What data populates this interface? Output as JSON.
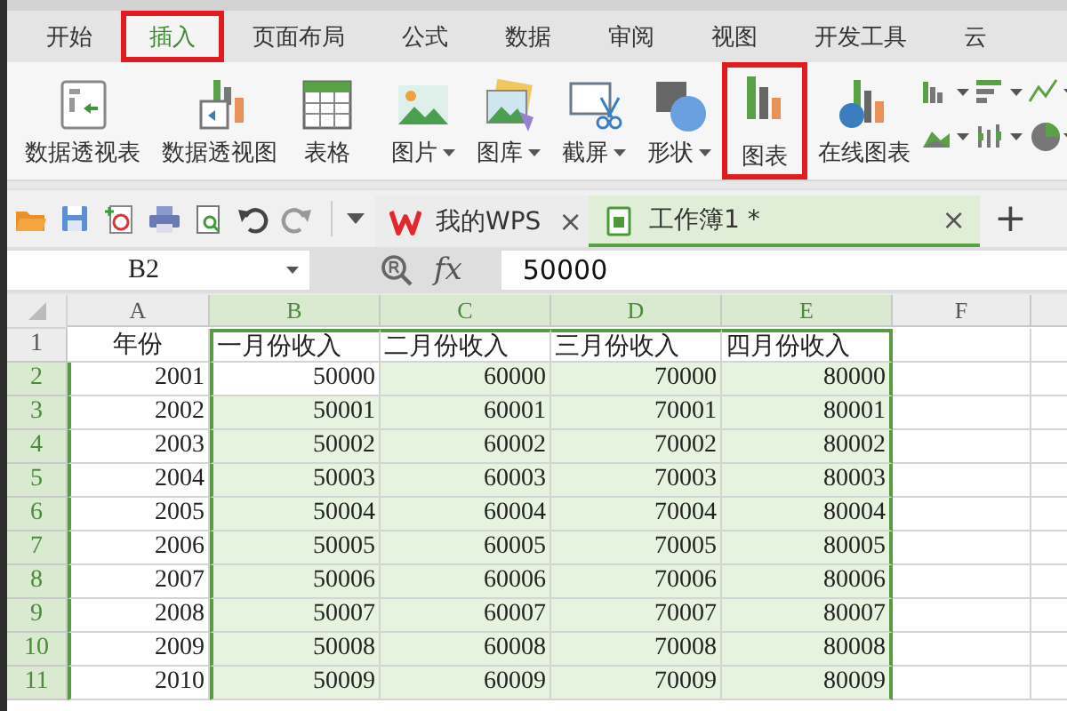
{
  "tabs": [
    {
      "label": "开始",
      "selected": false,
      "highlighted": false
    },
    {
      "label": "插入",
      "selected": true,
      "highlighted": true
    },
    {
      "label": "页面布局",
      "selected": false,
      "highlighted": false
    },
    {
      "label": "公式",
      "selected": false,
      "highlighted": false
    },
    {
      "label": "数据",
      "selected": false,
      "highlighted": false
    },
    {
      "label": "审阅",
      "selected": false,
      "highlighted": false
    },
    {
      "label": "视图",
      "selected": false,
      "highlighted": false
    },
    {
      "label": "开发工具",
      "selected": false,
      "highlighted": false
    },
    {
      "label": "云",
      "selected": false,
      "highlighted": false
    }
  ],
  "ribbon": {
    "items": [
      {
        "label": "数据透视表",
        "dropdown": false,
        "highlighted": false
      },
      {
        "label": "数据透视图",
        "dropdown": false,
        "highlighted": false
      },
      {
        "label": "表格",
        "dropdown": false,
        "highlighted": false
      },
      {
        "label": "图片",
        "dropdown": true,
        "highlighted": false
      },
      {
        "label": "图库",
        "dropdown": true,
        "highlighted": false
      },
      {
        "label": "截屏",
        "dropdown": true,
        "highlighted": false
      },
      {
        "label": "形状",
        "dropdown": true,
        "highlighted": false
      },
      {
        "label": "图表",
        "dropdown": false,
        "highlighted": true
      },
      {
        "label": "在线图表",
        "dropdown": false,
        "highlighted": false
      }
    ]
  },
  "doc_tabs": [
    {
      "label": "我的WPS",
      "close": "×",
      "selected": false
    },
    {
      "label": "工作簿1 *",
      "close": "×",
      "selected": true
    }
  ],
  "new_tab": "+",
  "formula_bar": {
    "name_box": "B2",
    "fx": "fx",
    "value": "50000"
  },
  "sheet": {
    "columns": [
      {
        "label": "A",
        "selected": false
      },
      {
        "label": "B",
        "selected": true
      },
      {
        "label": "C",
        "selected": true
      },
      {
        "label": "D",
        "selected": true
      },
      {
        "label": "E",
        "selected": true
      },
      {
        "label": "F",
        "selected": false
      }
    ],
    "rows": [
      {
        "number": "1",
        "kind": "header",
        "selected": false,
        "cells": [
          "年份",
          "一月份收入",
          "二月份收入",
          "三月份收入",
          "四月份收入"
        ]
      },
      {
        "number": "2",
        "kind": "data",
        "selected": true,
        "active": true,
        "cells": [
          "2001",
          "50000",
          "60000",
          "70000",
          "80000"
        ]
      },
      {
        "number": "3",
        "kind": "data",
        "selected": true,
        "active": false,
        "cells": [
          "2002",
          "50001",
          "60001",
          "70001",
          "80001"
        ]
      },
      {
        "number": "4",
        "kind": "data",
        "selected": true,
        "active": false,
        "cells": [
          "2003",
          "50002",
          "60002",
          "70002",
          "80002"
        ]
      },
      {
        "number": "5",
        "kind": "data",
        "selected": true,
        "active": false,
        "cells": [
          "2004",
          "50003",
          "60003",
          "70003",
          "80003"
        ]
      },
      {
        "number": "6",
        "kind": "data",
        "selected": true,
        "active": false,
        "cells": [
          "2005",
          "50004",
          "60004",
          "70004",
          "80004"
        ]
      },
      {
        "number": "7",
        "kind": "data",
        "selected": true,
        "active": false,
        "cells": [
          "2006",
          "50005",
          "60005",
          "70005",
          "80005"
        ]
      },
      {
        "number": "8",
        "kind": "data",
        "selected": true,
        "active": false,
        "cells": [
          "2007",
          "50006",
          "60006",
          "70006",
          "80006"
        ]
      },
      {
        "number": "9",
        "kind": "data",
        "selected": true,
        "active": false,
        "cells": [
          "2008",
          "50007",
          "60007",
          "70007",
          "80007"
        ]
      },
      {
        "number": "10",
        "kind": "data",
        "selected": true,
        "active": false,
        "cells": [
          "2009",
          "50008",
          "60008",
          "70008",
          "80008"
        ]
      },
      {
        "number": "11",
        "kind": "data",
        "selected": true,
        "active": false,
        "cells": [
          "2010",
          "50009",
          "60009",
          "70009",
          "80009"
        ]
      }
    ]
  }
}
